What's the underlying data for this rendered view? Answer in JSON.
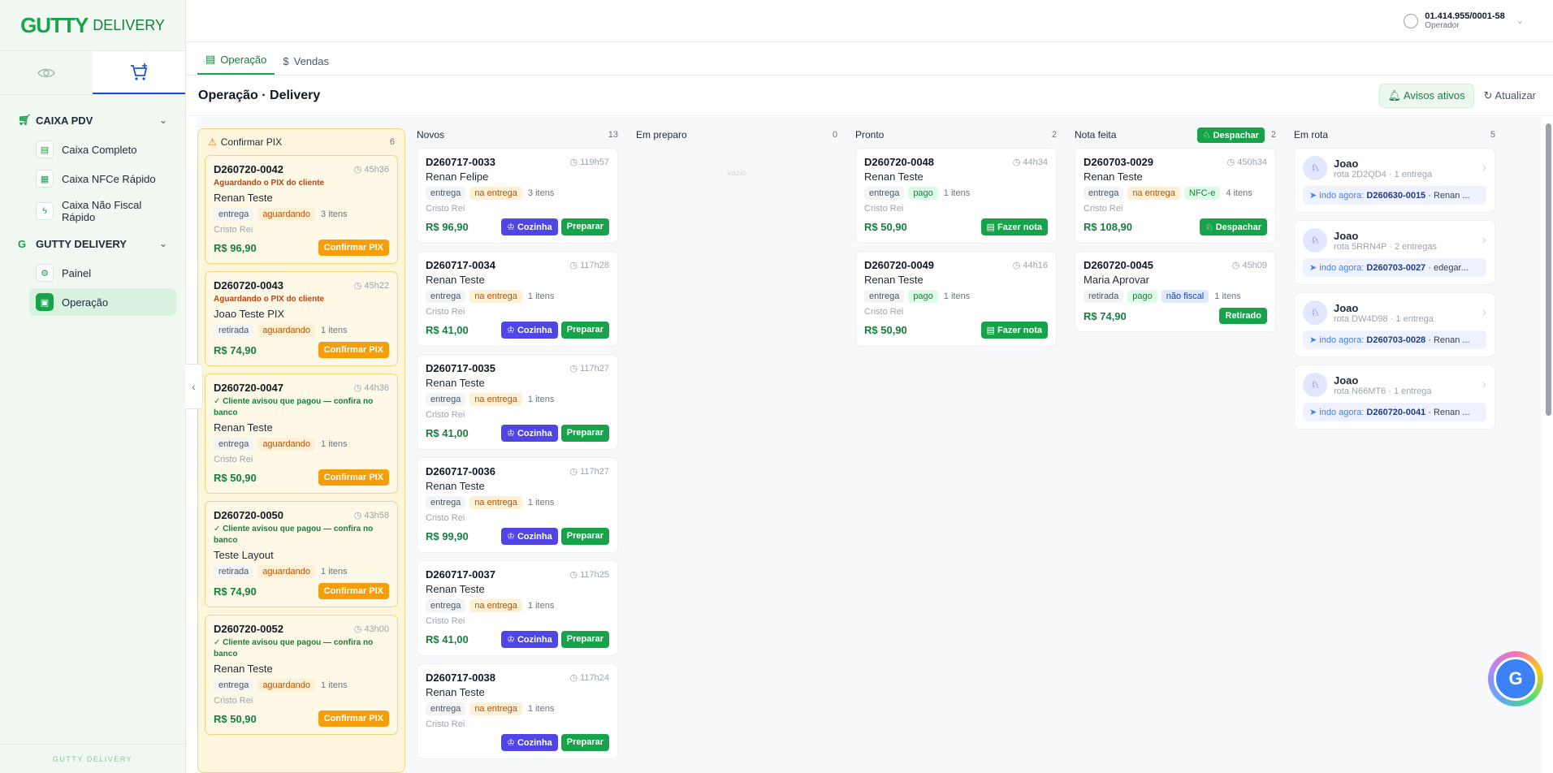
{
  "brand": {
    "name": "GUTTY",
    "suffix": "DELIVERY",
    "footer": "GUTTY DELIVERY"
  },
  "sidebar": {
    "groups": [
      {
        "label": "CAIXA PDV",
        "items": [
          {
            "label": "Caixa Completo"
          },
          {
            "label": "Caixa NFCe Rápido"
          },
          {
            "label": "Caixa Não Fiscal Rápido"
          }
        ]
      },
      {
        "label": "GUTTY DELIVERY",
        "items": [
          {
            "label": "Painel"
          },
          {
            "label": "Operação"
          }
        ]
      }
    ]
  },
  "user": {
    "cnpj": "01.414.955/0001-58",
    "role": "Operador"
  },
  "tabs": [
    {
      "label": "Operação"
    },
    {
      "label": "Vendas"
    }
  ],
  "header": {
    "title": "Operação · Delivery",
    "alerts_label": "Avisos ativos",
    "refresh_label": "Atualizar"
  },
  "columns": {
    "pix": {
      "title": "Confirmar PIX",
      "count": "6",
      "cards": [
        {
          "id": "D260720-0042",
          "time": "45h36",
          "note": "Aguardando o PIX do cliente",
          "name": "Renan Teste",
          "type": "entrega",
          "status": "aguardando",
          "items": "3 itens",
          "loc": "Cristo Rei",
          "price": "R$ 96,90",
          "action": "Confirmar PIX"
        },
        {
          "id": "D260720-0043",
          "time": "45h22",
          "note": "Aguardando o PIX do cliente",
          "name": "Joao Teste PIX",
          "type": "retirada",
          "status": "aguardando",
          "items": "1 itens",
          "loc": "",
          "price": "R$ 74,90",
          "action": "Confirmar PIX"
        },
        {
          "id": "D260720-0047",
          "time": "44h36",
          "note": "✓ Cliente avisou que pagou — confira no banco",
          "name": "Renan Teste",
          "type": "entrega",
          "status": "aguardando",
          "items": "1 itens",
          "loc": "Cristo Rei",
          "price": "R$ 50,90",
          "action": "Confirmar PIX"
        },
        {
          "id": "D260720-0050",
          "time": "43h58",
          "note": "✓ Cliente avisou que pagou — confira no banco",
          "name": "Teste Layout",
          "type": "retirada",
          "status": "aguardando",
          "items": "1 itens",
          "loc": "",
          "price": "R$ 74,90",
          "action": "Confirmar PIX"
        },
        {
          "id": "D260720-0052",
          "time": "43h00",
          "note": "✓ Cliente avisou que pagou — confira no banco",
          "name": "Renan Teste",
          "type": "entrega",
          "status": "aguardando",
          "items": "1 itens",
          "loc": "Cristo Rei",
          "price": "R$ 50,90",
          "action": "Confirmar PIX"
        }
      ]
    },
    "novos": {
      "title": "Novos",
      "count": "13",
      "cards": [
        {
          "id": "D260717-0033",
          "time": "119h57",
          "name": "Renan Felipe",
          "type": "entrega",
          "status": "na entrega",
          "items": "3 itens",
          "loc": "Cristo Rei",
          "price": "R$ 96,90"
        },
        {
          "id": "D260717-0034",
          "time": "117h28",
          "name": "Renan Teste",
          "type": "entrega",
          "status": "na entrega",
          "items": "1 itens",
          "loc": "Cristo Rei",
          "price": "R$ 41,00"
        },
        {
          "id": "D260717-0035",
          "time": "117h27",
          "name": "Renan Teste",
          "type": "entrega",
          "status": "na entrega",
          "items": "1 itens",
          "loc": "Cristo Rei",
          "price": "R$ 41,00"
        },
        {
          "id": "D260717-0036",
          "time": "117h27",
          "name": "Renan Teste",
          "type": "entrega",
          "status": "na entrega",
          "items": "1 itens",
          "loc": "Cristo Rei",
          "price": "R$ 99,90"
        },
        {
          "id": "D260717-0037",
          "time": "117h25",
          "name": "Renan Teste",
          "type": "entrega",
          "status": "na entrega",
          "items": "1 itens",
          "loc": "Cristo Rei",
          "price": "R$ 41,00"
        },
        {
          "id": "D260717-0038",
          "time": "117h24",
          "name": "Renan Teste",
          "type": "entrega",
          "status": "na entrega",
          "items": "1 itens",
          "loc": "Cristo Rei",
          "price": ""
        }
      ],
      "kitchen_label": "Cozinha",
      "prepare_label": "Preparar"
    },
    "preparo": {
      "title": "Em preparo",
      "count": "0",
      "empty": "vazio"
    },
    "pronto": {
      "title": "Pronto",
      "count": "2",
      "cards": [
        {
          "id": "D260720-0048",
          "time": "44h34",
          "name": "Renan Teste",
          "type": "entrega",
          "status": "pago",
          "items": "1 itens",
          "loc": "Cristo Rei",
          "price": "R$ 50,90",
          "action": "Fazer nota"
        },
        {
          "id": "D260720-0049",
          "time": "44h16",
          "name": "Renan Teste",
          "type": "entrega",
          "status": "pago",
          "items": "1 itens",
          "loc": "Cristo Rei",
          "price": "R$ 50,90",
          "action": "Fazer nota"
        }
      ]
    },
    "nota": {
      "title": "Nota feita",
      "count": "2",
      "dispatch_label": "Despachar",
      "cards": [
        {
          "id": "D260703-0029",
          "time": "450h34",
          "name": "Renan Teste",
          "type": "entrega",
          "status": "na entrega",
          "extra": "NFC-e",
          "items": "4 itens",
          "loc": "Cristo Rei",
          "price": "R$ 108,90",
          "action": "Despachar"
        },
        {
          "id": "D260720-0045",
          "time": "45h09",
          "name": "Maria Aprovar",
          "type": "retirada",
          "status": "pago",
          "extra": "não fiscal",
          "items": "1 itens",
          "loc": "",
          "price": "R$ 74,90",
          "action": "Retirado"
        }
      ]
    },
    "rota": {
      "title": "Em rota",
      "count": "5",
      "riders": [
        {
          "name": "Joao",
          "sub": "rota 2D2QD4 · 1 entrega",
          "now_label": "indo agora:",
          "order": "D260630-0015",
          "rest": "· Renan ..."
        },
        {
          "name": "Joao",
          "sub": "rota 5RRN4P · 2 entregas",
          "now_label": "indo agora:",
          "order": "D260703-0027",
          "rest": "· edegar..."
        },
        {
          "name": "Joao",
          "sub": "rota DW4D98 · 1 entrega",
          "now_label": "indo agora:",
          "order": "D260703-0028",
          "rest": "· Renan ..."
        },
        {
          "name": "Joao",
          "sub": "rota N66MT6 · 1 entrega",
          "now_label": "indo agora:",
          "order": "D260720-0041",
          "rest": "· Renan ..."
        }
      ]
    }
  },
  "assistant": {
    "letter": "G"
  }
}
